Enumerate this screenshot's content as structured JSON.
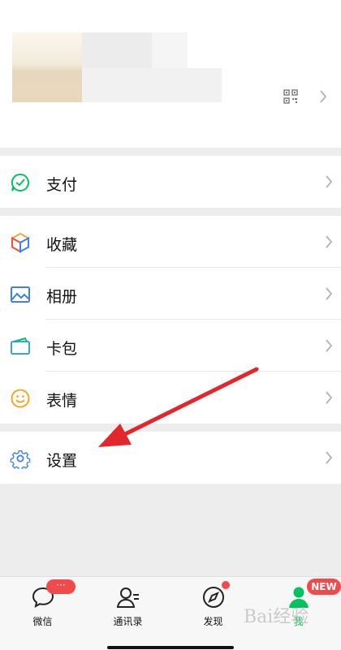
{
  "menu": {
    "pay": "支付",
    "favorites": "收藏",
    "album": "相册",
    "cards": "卡包",
    "stickers": "表情",
    "settings": "设置"
  },
  "tabbar": {
    "chats": "微信",
    "contacts": "通讯录",
    "discover": "发现",
    "me": "我",
    "chats_badge": "···",
    "me_badge": "NEW"
  },
  "watermark": "Bai经验",
  "colors": {
    "accent_green": "#07c160",
    "badge_red": "#f04a4a",
    "arrow_red": "#e3262b"
  }
}
